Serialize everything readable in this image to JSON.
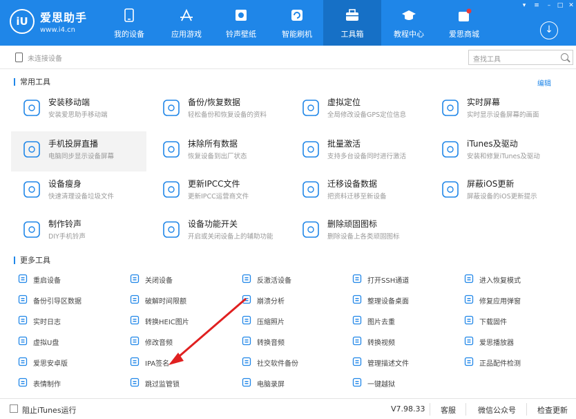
{
  "app": {
    "name": "爱思助手",
    "url": "www.i4.cn",
    "badge": "iU"
  },
  "nav": [
    {
      "label": "我的设备",
      "icon": "phone-icon"
    },
    {
      "label": "应用游戏",
      "icon": "app-store-icon"
    },
    {
      "label": "铃声壁纸",
      "icon": "wallpaper-icon"
    },
    {
      "label": "智能刷机",
      "icon": "flash-icon"
    },
    {
      "label": "工具箱",
      "icon": "toolbox-icon"
    },
    {
      "label": "教程中心",
      "icon": "graduation-cap-icon"
    },
    {
      "label": "爱思商城",
      "icon": "shop-icon"
    }
  ],
  "device_status": "未连接设备",
  "search": {
    "placeholder": "查找工具"
  },
  "common_tools": {
    "title": "常用工具",
    "edit": "编辑",
    "items": [
      {
        "name": "安装移动端",
        "desc": "安装爱思助手移动端",
        "icon": "mobile-install-icon"
      },
      {
        "name": "备份/恢复数据",
        "desc": "轻松备份和恢复设备的资料",
        "icon": "umbrella-icon"
      },
      {
        "name": "虚拟定位",
        "desc": "全局修改设备GPS定位信息",
        "icon": "location-pin-icon"
      },
      {
        "name": "实时屏幕",
        "desc": "实时显示设备屏幕的画面",
        "icon": "screen-share-icon"
      },
      {
        "name": "手机投屏直播",
        "desc": "电脑同步显示设备屏幕",
        "icon": "screen-cast-icon"
      },
      {
        "name": "抹除所有数据",
        "desc": "恢复设备到出厂状态",
        "icon": "eraser-icon"
      },
      {
        "name": "批量激活",
        "desc": "支持多台设备同时进行激活",
        "icon": "batch-activate-icon"
      },
      {
        "name": "iTunes及驱动",
        "desc": "安装和修复iTunes及驱动",
        "icon": "itunes-icon"
      },
      {
        "name": "设备瘦身",
        "desc": "快速清理设备垃圾文件",
        "icon": "broom-icon"
      },
      {
        "name": "更新IPCC文件",
        "desc": "更新IPCC运营商文件",
        "icon": "ipcc-file-icon"
      },
      {
        "name": "迁移设备数据",
        "desc": "把资料迁移至新设备",
        "icon": "migrate-icon"
      },
      {
        "name": "屏蔽iOS更新",
        "desc": "屏蔽设备的iOS更新提示",
        "icon": "block-update-icon"
      },
      {
        "name": "制作铃声",
        "desc": "DIY手机铃声",
        "icon": "ringtone-bell-icon"
      },
      {
        "name": "设备功能开关",
        "desc": "开启或关闭设备上的辅助功能",
        "icon": "toggle-icon"
      },
      {
        "name": "删除顽固图标",
        "desc": "删除设备上各类顽固图标",
        "icon": "pie-icon"
      }
    ]
  },
  "more_tools": {
    "title": "更多工具",
    "items": [
      {
        "label": "重启设备",
        "icon": "restart-icon"
      },
      {
        "label": "关闭设备",
        "icon": "power-icon"
      },
      {
        "label": "反激活设备",
        "icon": "deactivate-icon"
      },
      {
        "label": "打开SSH通道",
        "icon": "ssh-icon"
      },
      {
        "label": "进入恢复模式",
        "icon": "recovery-mode-icon"
      },
      {
        "label": "备份引导区数据",
        "icon": "backup-boot-icon"
      },
      {
        "label": "破解时间限额",
        "icon": "hourglass-icon"
      },
      {
        "label": "崩溃分析",
        "icon": "crash-analysis-icon"
      },
      {
        "label": "整理设备桌面",
        "icon": "grid-desktop-icon"
      },
      {
        "label": "修复应用弹窗",
        "icon": "repair-popup-icon"
      },
      {
        "label": "实时日志",
        "icon": "log-icon"
      },
      {
        "label": "转换HEIC图片",
        "icon": "heic-convert-icon"
      },
      {
        "label": "压缩照片",
        "icon": "compress-photo-icon"
      },
      {
        "label": "图片去重",
        "icon": "image-dedupe-icon"
      },
      {
        "label": "下载固件",
        "icon": "download-firmware-icon"
      },
      {
        "label": "虚拟U盘",
        "icon": "usb-drive-icon"
      },
      {
        "label": "修改音频",
        "icon": "audio-edit-icon"
      },
      {
        "label": "转换音频",
        "icon": "audio-convert-icon"
      },
      {
        "label": "转换视频",
        "icon": "video-convert-icon"
      },
      {
        "label": "爱思播放器",
        "icon": "player-icon"
      },
      {
        "label": "爱思安卓版",
        "icon": "android-app-icon"
      },
      {
        "label": "IPA签名",
        "icon": "ipa-sign-icon"
      },
      {
        "label": "社交软件备份",
        "icon": "social-backup-icon"
      },
      {
        "label": "管理描述文件",
        "icon": "profile-manage-icon"
      },
      {
        "label": "正品配件检测",
        "icon": "accessory-check-icon"
      },
      {
        "label": "表情制作",
        "icon": "emoji-icon"
      },
      {
        "label": "跳过监管锁",
        "icon": "skip-supervision-icon"
      },
      {
        "label": "电脑录屏",
        "icon": "screen-record-icon"
      },
      {
        "label": "一键越狱",
        "icon": "jailbreak-lock-icon"
      }
    ]
  },
  "bottom": {
    "block_itunes": "阻止iTunes运行",
    "version": "V7.98.33",
    "support": "客服",
    "wechat": "微信公众号",
    "update": "检查更新"
  },
  "colors": {
    "brand": "#1f86e8",
    "active_tab": "#1670c6",
    "annotation_arrow": "#e02020"
  }
}
